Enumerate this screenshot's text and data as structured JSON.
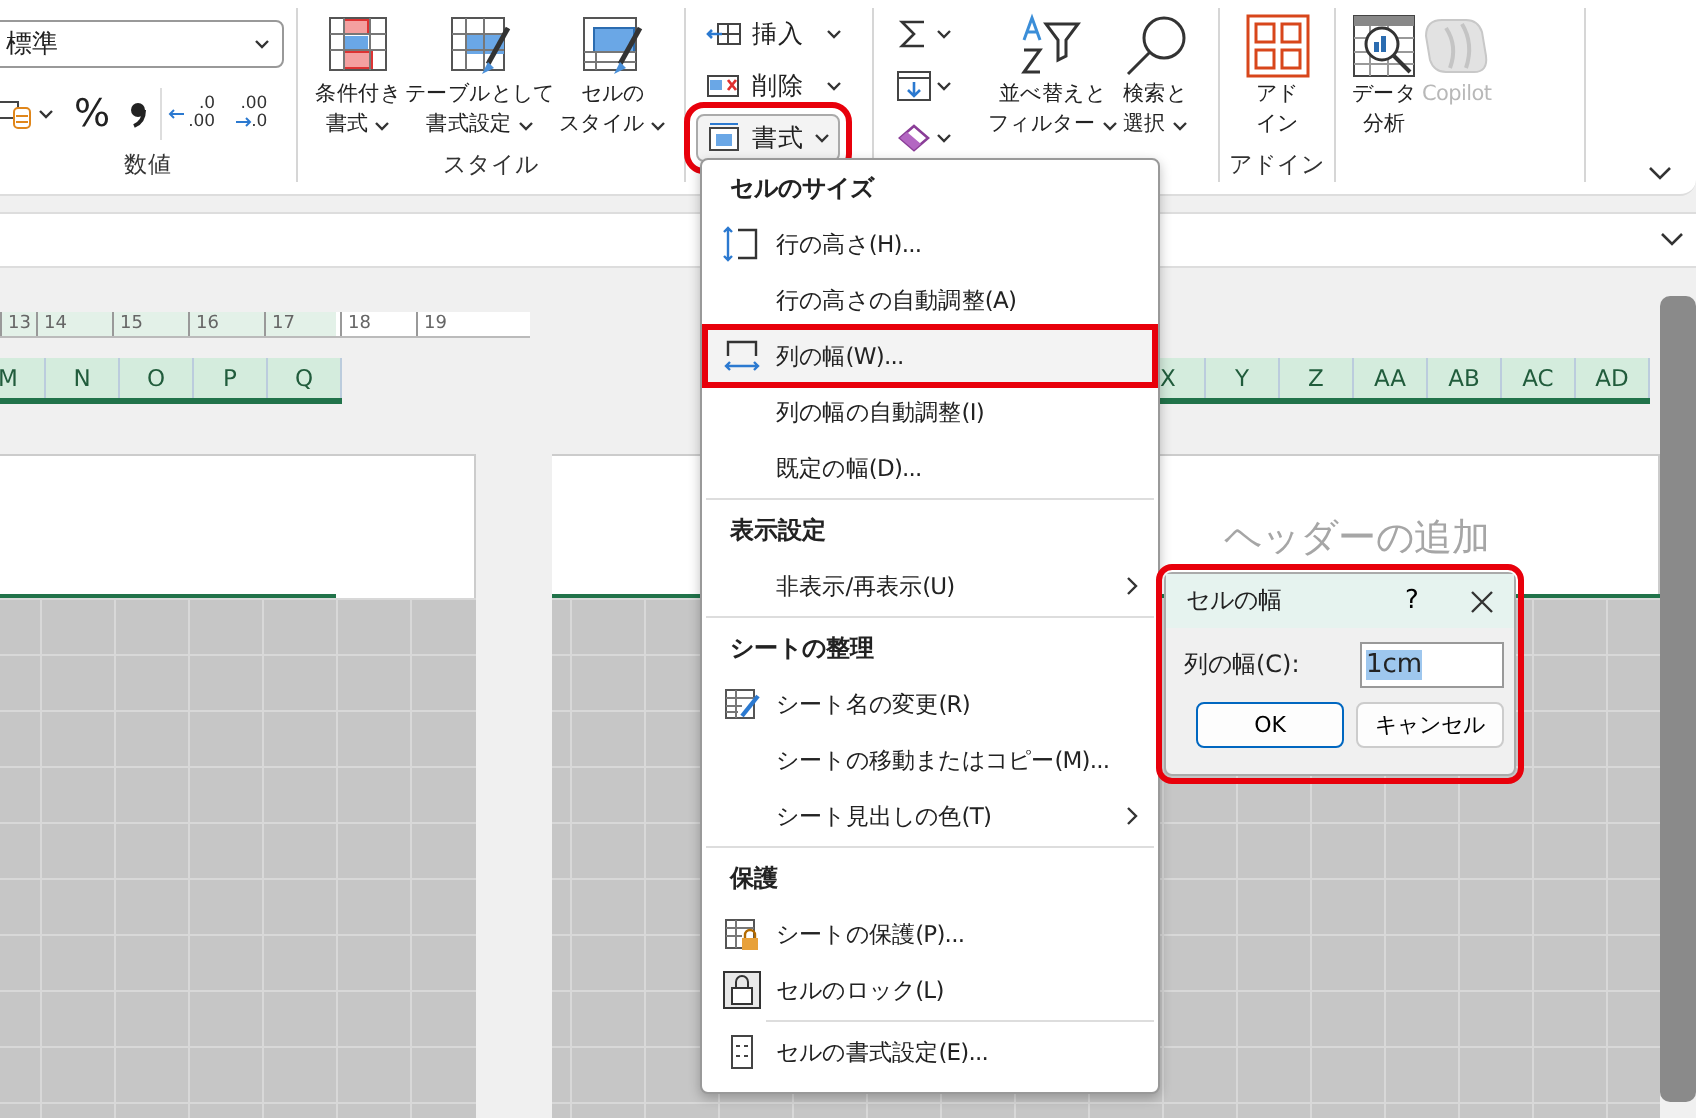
{
  "ribbon": {
    "number_group": {
      "format": "標準",
      "percent": "%",
      "increase_decimal": {
        "top": ".0",
        "bottom": ".00"
      },
      "decrease_decimal": {
        "top": ".00",
        "bottom": ".0"
      },
      "label": "数値"
    },
    "style_group": {
      "buttons": [
        {
          "kind": "conditional",
          "lines": [
            "条件付き",
            "書式"
          ]
        },
        {
          "kind": "table",
          "lines": [
            "テーブルとして",
            "書式設定"
          ]
        },
        {
          "kind": "cellstyle",
          "lines": [
            "セルの",
            "スタイル"
          ]
        }
      ],
      "label": "スタイル"
    },
    "cells_group": {
      "buttons": [
        {
          "kind": "insert",
          "label": "挿入",
          "highlighted": false
        },
        {
          "kind": "delete",
          "label": "削除",
          "highlighted": false
        },
        {
          "kind": "format",
          "label": "書式",
          "highlighted": true
        }
      ]
    },
    "editing_group": {
      "small": [
        {
          "kind": "sum"
        },
        {
          "kind": "fill"
        },
        {
          "kind": "clear"
        }
      ],
      "buttons": [
        {
          "kind": "sort",
          "lines": [
            "並べ替えと",
            "フィルター"
          ]
        },
        {
          "kind": "find",
          "lines": [
            "検索と",
            "選択"
          ]
        }
      ]
    },
    "addin_group": {
      "button": [
        "アド",
        "イン"
      ],
      "label": "アドイン"
    },
    "analysis_group": {
      "buttons": [
        {
          "kind": "analysis",
          "lines": [
            "データ",
            "分析"
          ],
          "disabled": false
        },
        {
          "kind": "copilot",
          "lines": [
            "Copilot"
          ],
          "disabled": true
        }
      ]
    }
  },
  "ruler": [
    "13",
    "14",
    "15",
    "16",
    "17",
    "18",
    "19"
  ],
  "columns_left": [
    "M",
    "N",
    "O",
    "P",
    "Q"
  ],
  "columns_right": [
    "X",
    "Y",
    "Z",
    "AA",
    "AB",
    "AC",
    "AD"
  ],
  "header_placeholder": "ヘッダーの追加",
  "menu": {
    "sections": [
      {
        "heading": "セルのサイズ",
        "items": [
          {
            "label": "行の高さ(H)...",
            "kind": "row-height",
            "submenu": false,
            "selected": false,
            "highlighted": false
          },
          {
            "label": "行の高さの自動調整(A)",
            "submenu": false,
            "selected": false,
            "highlighted": false
          },
          {
            "label": "列の幅(W)...",
            "kind": "col-width",
            "submenu": false,
            "selected": true,
            "highlighted": true
          },
          {
            "label": "列の幅の自動調整(I)",
            "submenu": false,
            "selected": false,
            "highlighted": false
          },
          {
            "label": "既定の幅(D)...",
            "submenu": false,
            "selected": false,
            "highlighted": false
          }
        ]
      },
      {
        "heading": "表示設定",
        "items": [
          {
            "label": "非表示/再表示(U)",
            "submenu": true,
            "selected": false,
            "highlighted": false
          }
        ]
      },
      {
        "heading": "シートの整理",
        "items": [
          {
            "label": "シート名の変更(R)",
            "kind": "rename",
            "submenu": false,
            "selected": false,
            "highlighted": false
          },
          {
            "label": "シートの移動またはコピー(M)...",
            "submenu": false,
            "selected": false,
            "highlighted": false
          },
          {
            "label": "シート見出しの色(T)",
            "submenu": true,
            "selected": false,
            "highlighted": false
          }
        ]
      },
      {
        "heading": "保護",
        "items": [
          {
            "label": "シートの保護(P)...",
            "kind": "protect",
            "submenu": false,
            "selected": false,
            "highlighted": false
          },
          {
            "label": "セルのロック(L)",
            "kind": "lock",
            "submenu": false,
            "selected": false,
            "highlighted": false
          }
        ]
      },
      {
        "items": [
          {
            "label": "セルの書式設定(E)...",
            "kind": "format-cells",
            "submenu": false,
            "selected": false,
            "highlighted": false
          }
        ]
      }
    ]
  },
  "dialog": {
    "title": "セルの幅",
    "help": "?",
    "field_label": "列の幅(C):",
    "value": "1cm",
    "highlighted": true,
    "buttons": [
      {
        "label": "OK",
        "default": true
      },
      {
        "label": "キャンセル",
        "default": false
      }
    ]
  }
}
